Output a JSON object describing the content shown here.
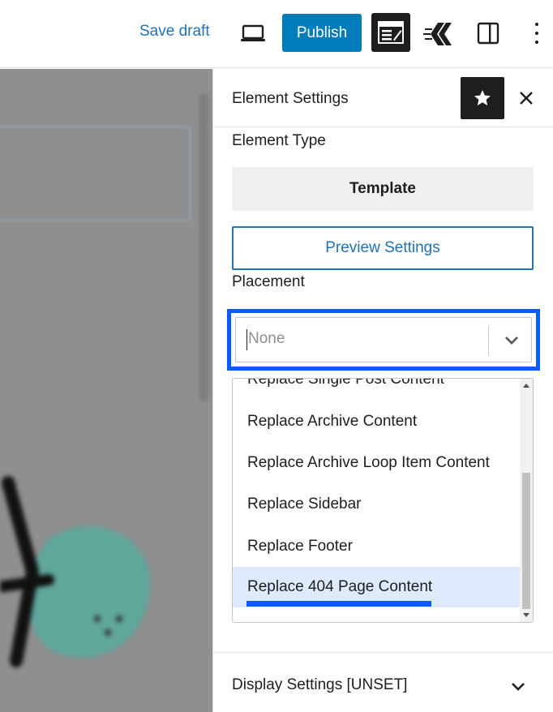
{
  "toolbar": {
    "save_draft_label": "Save draft",
    "publish_label": "Publish"
  },
  "sidebar": {
    "title": "Element Settings",
    "element_type_label": "Element Type",
    "element_type_value": "Template",
    "preview_settings_label": "Preview Settings",
    "placement_label": "Placement",
    "placement_select": {
      "placeholder": "None",
      "options": [
        "Replace Single Post Content",
        "Replace Archive Content",
        "Replace Archive Loop Item Content",
        "Replace Sidebar",
        "Replace Footer",
        "Replace 404 Page Content"
      ],
      "highlighted_option": "Replace 404 Page Content"
    },
    "display_settings_label": "Display Settings [UNSET]"
  },
  "colors": {
    "accent": "#007cba",
    "link": "#2271b1",
    "focus": "#0a5cff",
    "highlight": "#deebff"
  }
}
